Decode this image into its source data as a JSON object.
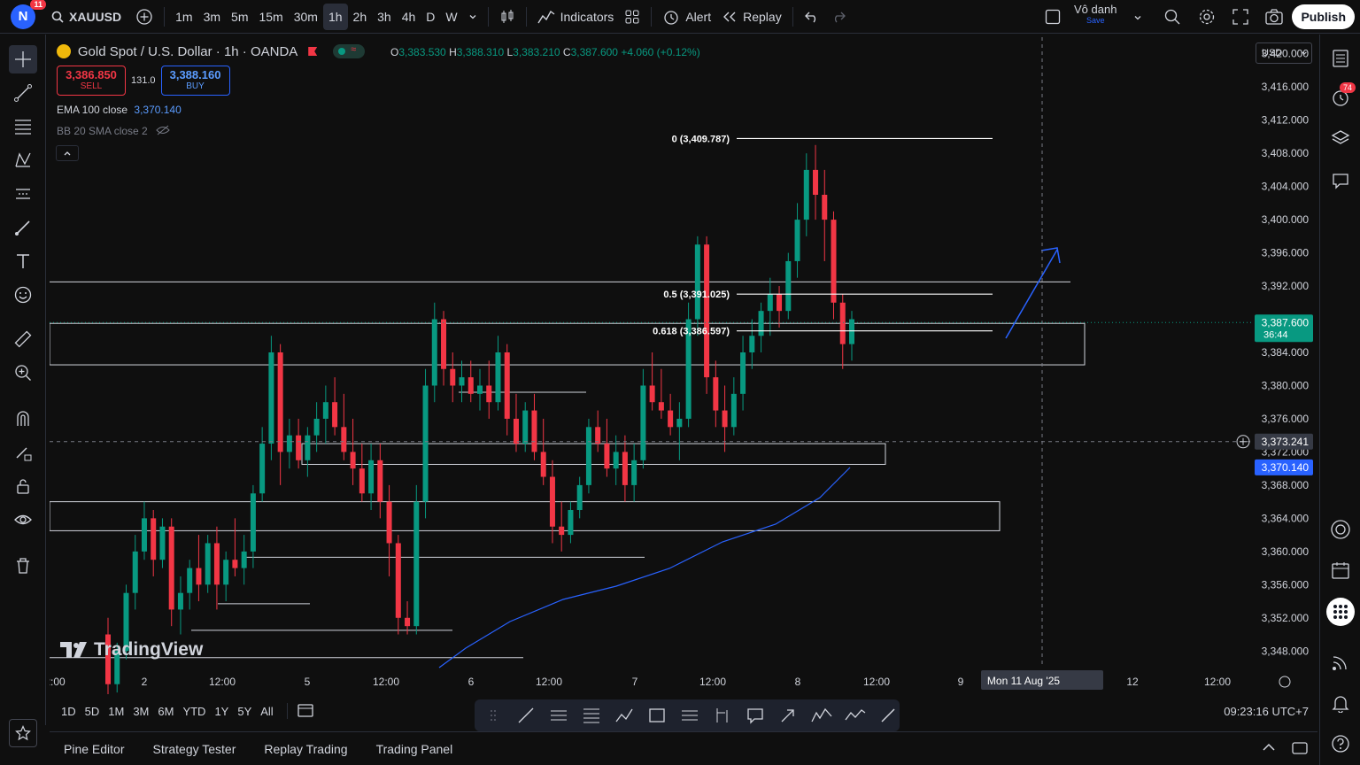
{
  "user": {
    "initial": "N",
    "notifications": "11"
  },
  "symbol": "XAUUSD",
  "intervals": [
    "1m",
    "3m",
    "5m",
    "15m",
    "30m",
    "1h",
    "2h",
    "3h",
    "4h",
    "D",
    "W"
  ],
  "active_interval": "1h",
  "toolbar": {
    "indicators": "Indicators",
    "alert": "Alert",
    "replay": "Replay",
    "publish": "Publish"
  },
  "layout": {
    "name": "Vô danh",
    "status": "Save"
  },
  "legend": {
    "title": "Gold Spot / U.S. Dollar · 1h · OANDA",
    "o_label": "O",
    "o": "3,383.530",
    "h_label": "H",
    "h": "3,388.310",
    "l_label": "L",
    "l": "3,383.210",
    "c_label": "C",
    "c": "3,387.600",
    "change": "+4.060 (+0.12%)"
  },
  "trade": {
    "sell_price": "3,386.850",
    "sell_label": "SELL",
    "spread": "131.0",
    "buy_price": "3,388.160",
    "buy_label": "BUY"
  },
  "indicators": {
    "ema_label": "EMA 100 close",
    "ema_value": "3,370.140",
    "bb_label": "BB 20 SMA close 2"
  },
  "currency": "USD",
  "chart_data": {
    "type": "candlestick",
    "symbol": "XAUUSD",
    "interval": "1h",
    "price_axis": [
      "3,420.000",
      "3,416.000",
      "3,412.000",
      "3,408.000",
      "3,404.000",
      "3,400.000",
      "3,396.000",
      "3,392.000",
      "3,388.000",
      "3,384.000",
      "3,380.000",
      "3,376.000",
      "3,372.000",
      "3,368.000",
      "3,364.000",
      "3,360.000",
      "3,356.000",
      "3,352.000",
      "3,348.000"
    ],
    "ylim": [
      3346,
      3422
    ],
    "time_axis": [
      "2:00",
      "2",
      "12:00",
      "5",
      "12:00",
      "6",
      "12:00",
      "7",
      "12:00",
      "8",
      "12:00",
      "9",
      "12:00",
      "12",
      "12:00"
    ],
    "price_labels": {
      "last": "3,387.600",
      "countdown": "36:44",
      "crosshair": "3,373.241",
      "ema": "3,370.140"
    },
    "crosshair_time": "Mon 11 Aug '25",
    "fib": [
      {
        "label": "0 (3,409.787)",
        "price": 3409.787
      },
      {
        "label": "0.5 (3,391.025)",
        "price": 3391.025
      },
      {
        "label": "0.618 (3,386.597)",
        "price": 3386.597
      }
    ],
    "zones": [
      {
        "top": 3387.5,
        "bottom": 3382.5
      },
      {
        "top": 3373.0,
        "bottom": 3370.5
      },
      {
        "top": 3366.0,
        "bottom": 3362.5
      }
    ],
    "hlines": [
      3392.5,
      3379.2,
      3359.3,
      3353.7,
      3350.5,
      3347.2
    ],
    "candles": [
      [
        3350,
        3352,
        3342,
        3344
      ],
      [
        3344,
        3349,
        3343,
        3348
      ],
      [
        3348,
        3356,
        3347,
        3355
      ],
      [
        3355,
        3362,
        3353,
        3360
      ],
      [
        3360,
        3366,
        3359,
        3364
      ],
      [
        3364,
        3365,
        3357,
        3359
      ],
      [
        3359,
        3364,
        3358,
        3363
      ],
      [
        3363,
        3364,
        3351,
        3353
      ],
      [
        3353,
        3357,
        3350,
        3355
      ],
      [
        3355,
        3359,
        3353,
        3358
      ],
      [
        3358,
        3362,
        3354,
        3356
      ],
      [
        3356,
        3362,
        3355,
        3361
      ],
      [
        3361,
        3363,
        3353,
        3356
      ],
      [
        3356,
        3360,
        3354,
        3359
      ],
      [
        3359,
        3364,
        3357,
        3358
      ],
      [
        3358,
        3362,
        3356,
        3360
      ],
      [
        3360,
        3368,
        3358,
        3367
      ],
      [
        3367,
        3375,
        3366,
        3373
      ],
      [
        3373,
        3386,
        3371,
        3384
      ],
      [
        3384,
        3385,
        3368,
        3372
      ],
      [
        3372,
        3376,
        3370,
        3374
      ],
      [
        3374,
        3376,
        3370,
        3371
      ],
      [
        3371,
        3375,
        3369,
        3374
      ],
      [
        3374,
        3378,
        3372,
        3376
      ],
      [
        3376,
        3380,
        3373,
        3378
      ],
      [
        3378,
        3381,
        3374,
        3375
      ],
      [
        3375,
        3379,
        3371,
        3372
      ],
      [
        3372,
        3376,
        3368,
        3370
      ],
      [
        3370,
        3373,
        3366,
        3367
      ],
      [
        3367,
        3373,
        3365,
        3371
      ],
      [
        3371,
        3373,
        3364,
        3366
      ],
      [
        3366,
        3368,
        3357,
        3361
      ],
      [
        3361,
        3362,
        3350,
        3352
      ],
      [
        3352,
        3354,
        3350,
        3351
      ],
      [
        3351,
        3368,
        3350,
        3366
      ],
      [
        3366,
        3382,
        3364,
        3380
      ],
      [
        3380,
        3390,
        3378,
        3388
      ],
      [
        3388,
        3389,
        3380,
        3382
      ],
      [
        3382,
        3384,
        3378,
        3380
      ],
      [
        3380,
        3383,
        3378,
        3381
      ],
      [
        3381,
        3383,
        3378,
        3379
      ],
      [
        3379,
        3382,
        3377,
        3380
      ],
      [
        3380,
        3383,
        3376,
        3378
      ],
      [
        3378,
        3386,
        3377,
        3384
      ],
      [
        3384,
        3385,
        3374,
        3376
      ],
      [
        3376,
        3379,
        3372,
        3373
      ],
      [
        3373,
        3378,
        3372,
        3377
      ],
      [
        3377,
        3379,
        3371,
        3372
      ],
      [
        3372,
        3376,
        3368,
        3369
      ],
      [
        3369,
        3371,
        3361,
        3363
      ],
      [
        3363,
        3366,
        3360,
        3362
      ],
      [
        3362,
        3366,
        3361,
        3365
      ],
      [
        3365,
        3369,
        3364,
        3368
      ],
      [
        3368,
        3376,
        3367,
        3375
      ],
      [
        3375,
        3377,
        3372,
        3373
      ],
      [
        3373,
        3376,
        3369,
        3370
      ],
      [
        3370,
        3374,
        3368,
        3372
      ],
      [
        3372,
        3374,
        3366,
        3368
      ],
      [
        3368,
        3373,
        3366,
        3371
      ],
      [
        3371,
        3382,
        3370,
        3380
      ],
      [
        3380,
        3384,
        3377,
        3378
      ],
      [
        3378,
        3382,
        3376,
        3377
      ],
      [
        3377,
        3379,
        3374,
        3375
      ],
      [
        3375,
        3378,
        3371,
        3376
      ],
      [
        3376,
        3390,
        3375,
        3388
      ],
      [
        3388,
        3398,
        3386,
        3397
      ],
      [
        3397,
        3398,
        3379,
        3381
      ],
      [
        3381,
        3383,
        3375,
        3377
      ],
      [
        3377,
        3380,
        3372,
        3375
      ],
      [
        3375,
        3381,
        3374,
        3379
      ],
      [
        3379,
        3386,
        3377,
        3384
      ],
      [
        3384,
        3388,
        3382,
        3386
      ],
      [
        3386,
        3390,
        3384,
        3389
      ],
      [
        3389,
        3393,
        3386,
        3391
      ],
      [
        3391,
        3392,
        3387,
        3389
      ],
      [
        3389,
        3396,
        3388,
        3395
      ],
      [
        3395,
        3402,
        3393,
        3400
      ],
      [
        3400,
        3408,
        3398,
        3406
      ],
      [
        3406,
        3409,
        3400,
        3403
      ],
      [
        3403,
        3406,
        3395,
        3400
      ],
      [
        3400,
        3401,
        3388,
        3390
      ],
      [
        3390,
        3391,
        3382,
        3385
      ],
      [
        3385,
        3389,
        3383,
        3388
      ]
    ]
  },
  "timebar": {
    "ranges": [
      "1D",
      "5D",
      "1M",
      "3M",
      "6M",
      "YTD",
      "1Y",
      "5Y",
      "All"
    ],
    "clock": "09:23:16 UTC+7"
  },
  "bottom_tabs": [
    "Pine Editor",
    "Strategy Tester",
    "Replay Trading",
    "Trading Panel"
  ],
  "watermark": "TradingView",
  "right_badge": "74",
  "colors": {
    "up": "#089981",
    "down": "#f23645",
    "ema": "#2962ff",
    "accent": "#2962ff"
  }
}
